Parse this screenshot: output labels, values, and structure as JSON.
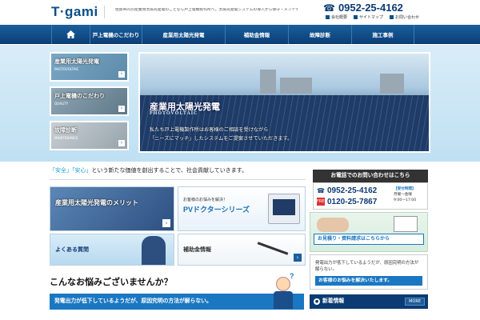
{
  "header": {
    "logo": "T·gami",
    "tagline": "佐賀県内の産業用太陽光発電のことなら戸上電機製作所へ。太陽光発電システムの導入から保守・メンテナンスまでご提案いたします。",
    "phone": "0952-25-4162",
    "links": [
      "会社概要",
      "サイトマップ",
      "お問い合わせ"
    ]
  },
  "nav": {
    "home_icon": "home-icon",
    "items": [
      "戸上電機のこだわり",
      "産業用太陽光発電",
      "補助金情報",
      "故障診断",
      "施工事例"
    ]
  },
  "hero": {
    "thumbs": [
      {
        "title": "産業用太陽光発電",
        "sub": "PHOTOVOLTAIC"
      },
      {
        "title": "戸上電機のこだわり",
        "sub": "QUALITY"
      },
      {
        "title": "故障診断",
        "sub": "MAINTENANCE"
      }
    ],
    "title": "産業用太陽光発電",
    "subtitle": "PHOTOVOLTAIC",
    "text_line1": "私たち戸上電機製作所はお客様のご相談を受けながら",
    "text_line2": "「ニーズにマッチ」したシステムをご提案させていただきます。"
  },
  "catch": {
    "part1": "「安全」「安心」",
    "part2": "という新たな価値を創出することで、社会貢献していきます。"
  },
  "banners": {
    "merit": "産業用太陽光発電のメリット",
    "pv_small": "お客様のお悩みを解決！",
    "pv_big": "PVドクターシリーズ",
    "faq": "よくある質問",
    "subsidy": "補助金情報"
  },
  "worry": {
    "title": "こんなお悩みございませんか？",
    "item1": "発電出力が低下しているようだが、原因究明の方法が解らない。"
  },
  "contact": {
    "head": "お電話でのお問い合わせはこちら",
    "phone1": "0952-25-4162",
    "free_label": "FREE",
    "phone2": "0120-25-7867",
    "hours_title": "【受付時間】",
    "hours_days": "月曜～金曜",
    "hours_time": "9:00～17:00"
  },
  "estimate": {
    "button": "お見積り・資料請求はこちらから"
  },
  "issue": {
    "text": "発電出力が低下しているようだが、原因究明の方法が解らない。",
    "button": "お客様のお悩みを解決いたします。"
  },
  "news": {
    "label": "新着情報",
    "more": "MORE"
  }
}
